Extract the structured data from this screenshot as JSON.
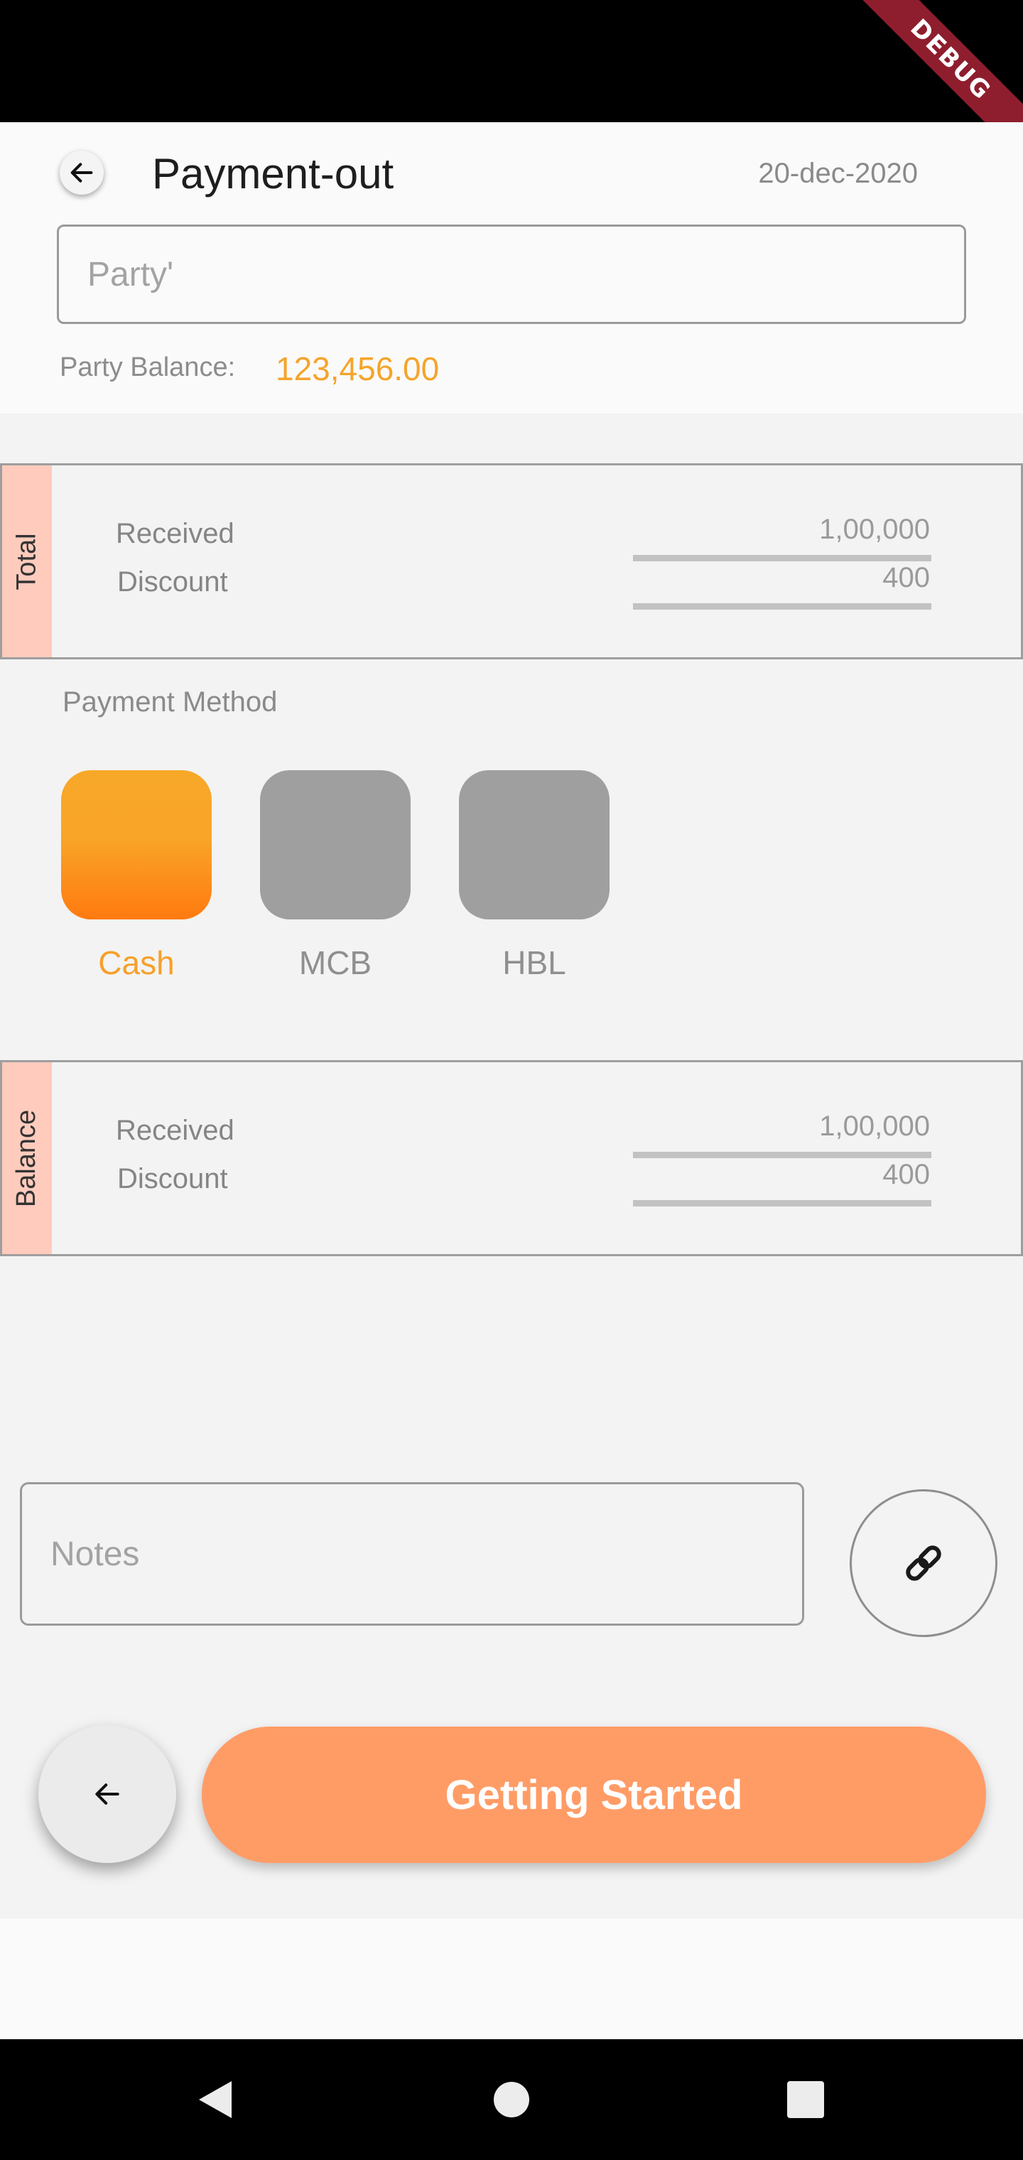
{
  "status_bar": {
    "debug_label": "DEBUG"
  },
  "header": {
    "title": "Payment-out",
    "date": "20-dec-2020",
    "party_placeholder": "Party'",
    "party_balance_label": "Party Balance:",
    "party_balance_value": "123,456.00"
  },
  "total_box": {
    "tab_label": "Total",
    "rows": [
      {
        "label": "Received",
        "value": "1,00,000"
      },
      {
        "label": "Discount",
        "value": "400"
      }
    ]
  },
  "payment_method": {
    "label": "Payment Method",
    "options": [
      {
        "label": "Cash",
        "selected": true
      },
      {
        "label": "MCB",
        "selected": false
      },
      {
        "label": "HBL",
        "selected": false
      }
    ]
  },
  "balance_box": {
    "tab_label": "Balance",
    "rows": [
      {
        "label": "Received",
        "value": "1,00,000"
      },
      {
        "label": "Discount",
        "value": "400"
      }
    ]
  },
  "notes": {
    "placeholder": "Notes"
  },
  "footer": {
    "primary_label": "Getting Started"
  },
  "colors": {
    "accent_orange": "#f6a42b",
    "primary_button": "#ff9c66",
    "side_tab": "#ffcbbd",
    "inactive_tile": "#9f9f9f"
  },
  "icons": {
    "back": "arrow-left",
    "attach": "link",
    "nav_back": "triangle-left",
    "nav_home": "circle",
    "nav_recents": "square"
  }
}
